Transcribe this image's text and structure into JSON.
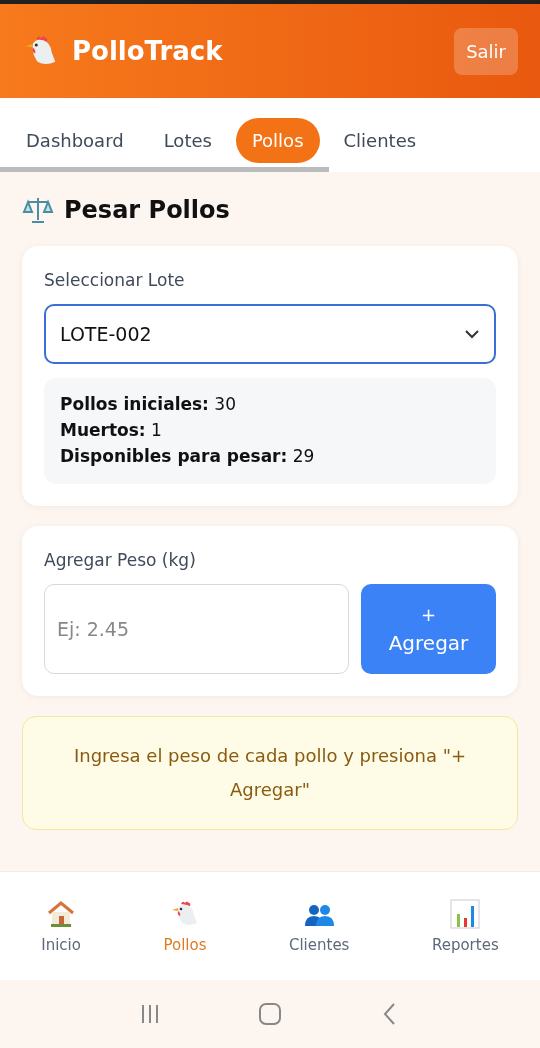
{
  "header": {
    "title": "PolloTrack",
    "logout": "Salir"
  },
  "tabs": [
    {
      "label": "Dashboard",
      "selected": false
    },
    {
      "label": "Lotes",
      "selected": false
    },
    {
      "label": "Pollos",
      "selected": true
    },
    {
      "label": "Clientes",
      "selected": false
    }
  ],
  "page_title": "Pesar Pollos",
  "lote_card": {
    "label": "Seleccionar Lote",
    "value": "LOTE-002",
    "info": [
      "**Pollos iniciales:** 30",
      "**Muertos:** 1",
      "**Disponibles para pesar:** 29"
    ]
  },
  "peso_card": {
    "label": "Agregar Peso (kg)",
    "placeholder": "Ej: 2.45",
    "button_icon": "+",
    "button": "Agregar"
  },
  "notice": "Ingresa el peso de cada pollo y presiona \"+ Agregar\"",
  "bottom_nav": [
    {
      "kind": "home",
      "label": "Inicio",
      "selected": false
    },
    {
      "kind": "chicken",
      "label": "Pollos",
      "selected": true
    },
    {
      "kind": "people",
      "label": "Clientes",
      "selected": false
    },
    {
      "kind": "chart",
      "label": "Reportes",
      "selected": false
    }
  ]
}
